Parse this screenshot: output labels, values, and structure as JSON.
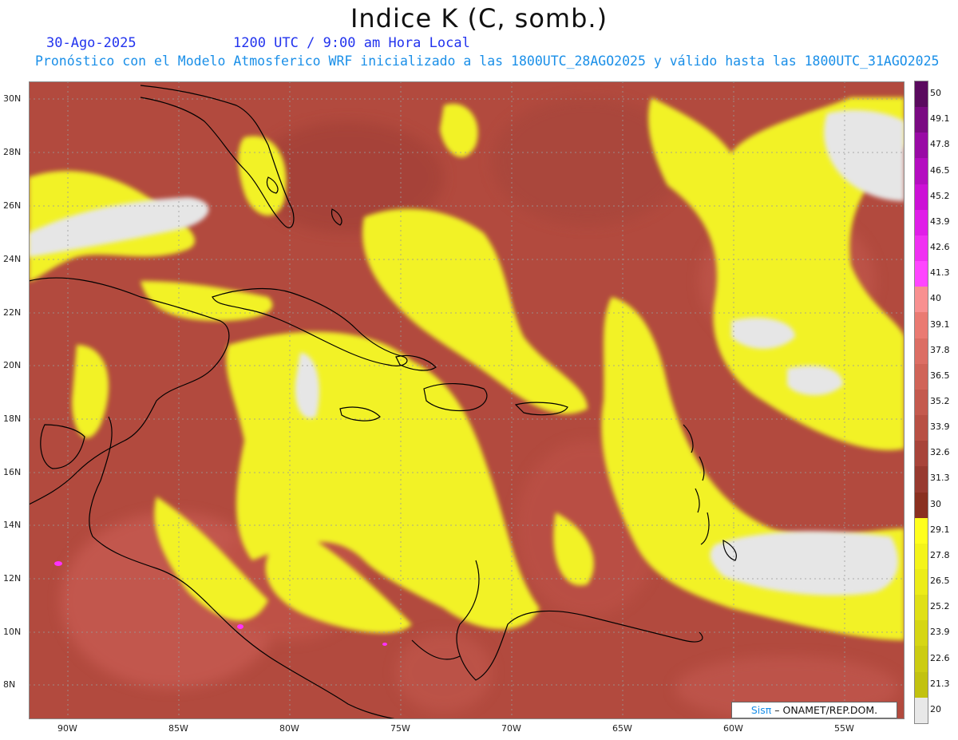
{
  "header": {
    "title": "Indice K (C, somb.)",
    "date": "30-Ago-2025",
    "valid_time": "1200 UTC / 9:00 am Hora Local",
    "subtitle": "Pronóstico con el Modelo Atmosferico WRF inicializado a las 1800UTC_28AGO2025 y válido hasta las  1800UTC_31AGO2025"
  },
  "axes": {
    "lat_labels": [
      "30N",
      "28N",
      "26N",
      "24N",
      "22N",
      "20N",
      "18N",
      "16N",
      "14N",
      "12N",
      "10N",
      "8N"
    ],
    "lon_labels": [
      "90W",
      "85W",
      "80W",
      "75W",
      "70W",
      "65W",
      "60W",
      "55W"
    ]
  },
  "colorbar": {
    "labels": [
      "50",
      "49.1",
      "47.8",
      "46.5",
      "45.2",
      "43.9",
      "42.6",
      "41.3",
      "40",
      "39.1",
      "37.8",
      "36.5",
      "35.2",
      "33.9",
      "32.6",
      "31.3",
      "30",
      "29.1",
      "27.8",
      "26.5",
      "25.2",
      "23.9",
      "22.6",
      "21.3",
      "20"
    ],
    "colors": [
      "#5a0a5e",
      "#7a0a82",
      "#990aa5",
      "#b40dc0",
      "#cc10d6",
      "#e01ee8",
      "#f030f2",
      "#ff45ff",
      "#f89090",
      "#ea7a72",
      "#dc6e64",
      "#d06458",
      "#c45a4e",
      "#b85044",
      "#a8443a",
      "#983a30",
      "#8a3020",
      "#ffff1e",
      "#f4f41a",
      "#ecec18",
      "#e0e016",
      "#d6d614",
      "#cccc12",
      "#c2c210",
      "#e8e8e8"
    ]
  },
  "credit": {
    "logo": "Sisπ",
    "text": " – ONAMET/REP.DOM."
  },
  "colors": {
    "dry_red": "#b24a3e",
    "moist_yellow": "#f2f228",
    "low_gray": "#e6e6e6",
    "coastline": "#000000"
  }
}
